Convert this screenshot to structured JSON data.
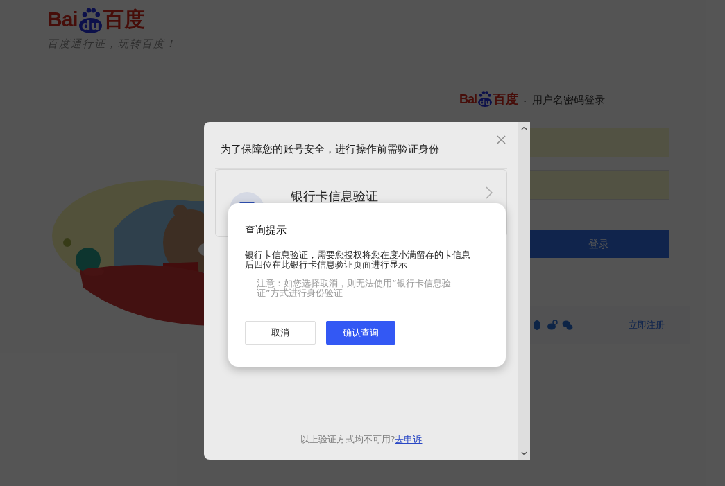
{
  "header": {
    "logo": {
      "latin": "Bai",
      "paw": "du",
      "chinese": "百度"
    },
    "slogan": "百度通行证，玩转百度！"
  },
  "login": {
    "logo": {
      "latin": "Bai",
      "paw": "du",
      "chinese": "百度"
    },
    "separator": "·",
    "title": "用户名密码登录",
    "fields": [
      {
        "autofilled": true
      },
      {
        "autofilled": true
      }
    ],
    "submit": "登录",
    "register_link": "立即注册"
  },
  "verify_dialog": {
    "title": "为了保障您的账号安全，进行操作前需验证身份",
    "methods": [
      {
        "label": "银行卡信息验证"
      }
    ],
    "footer": {
      "text": "以上验证方式均不可用?",
      "link": "去申诉"
    }
  },
  "confirm_dialog": {
    "title": "查询提示",
    "message": "银行卡信息验证，需要您授权将您在度小满留存的卡信息后四位在此银行卡信息验证页面进行显示",
    "note": "注意：如您选择取消，则无法使用“银行卡信息验证”方式进行身份验证",
    "buttons": [
      {
        "label": "取消",
        "primary": false
      },
      {
        "label": "确认查询",
        "primary": true
      }
    ]
  }
}
